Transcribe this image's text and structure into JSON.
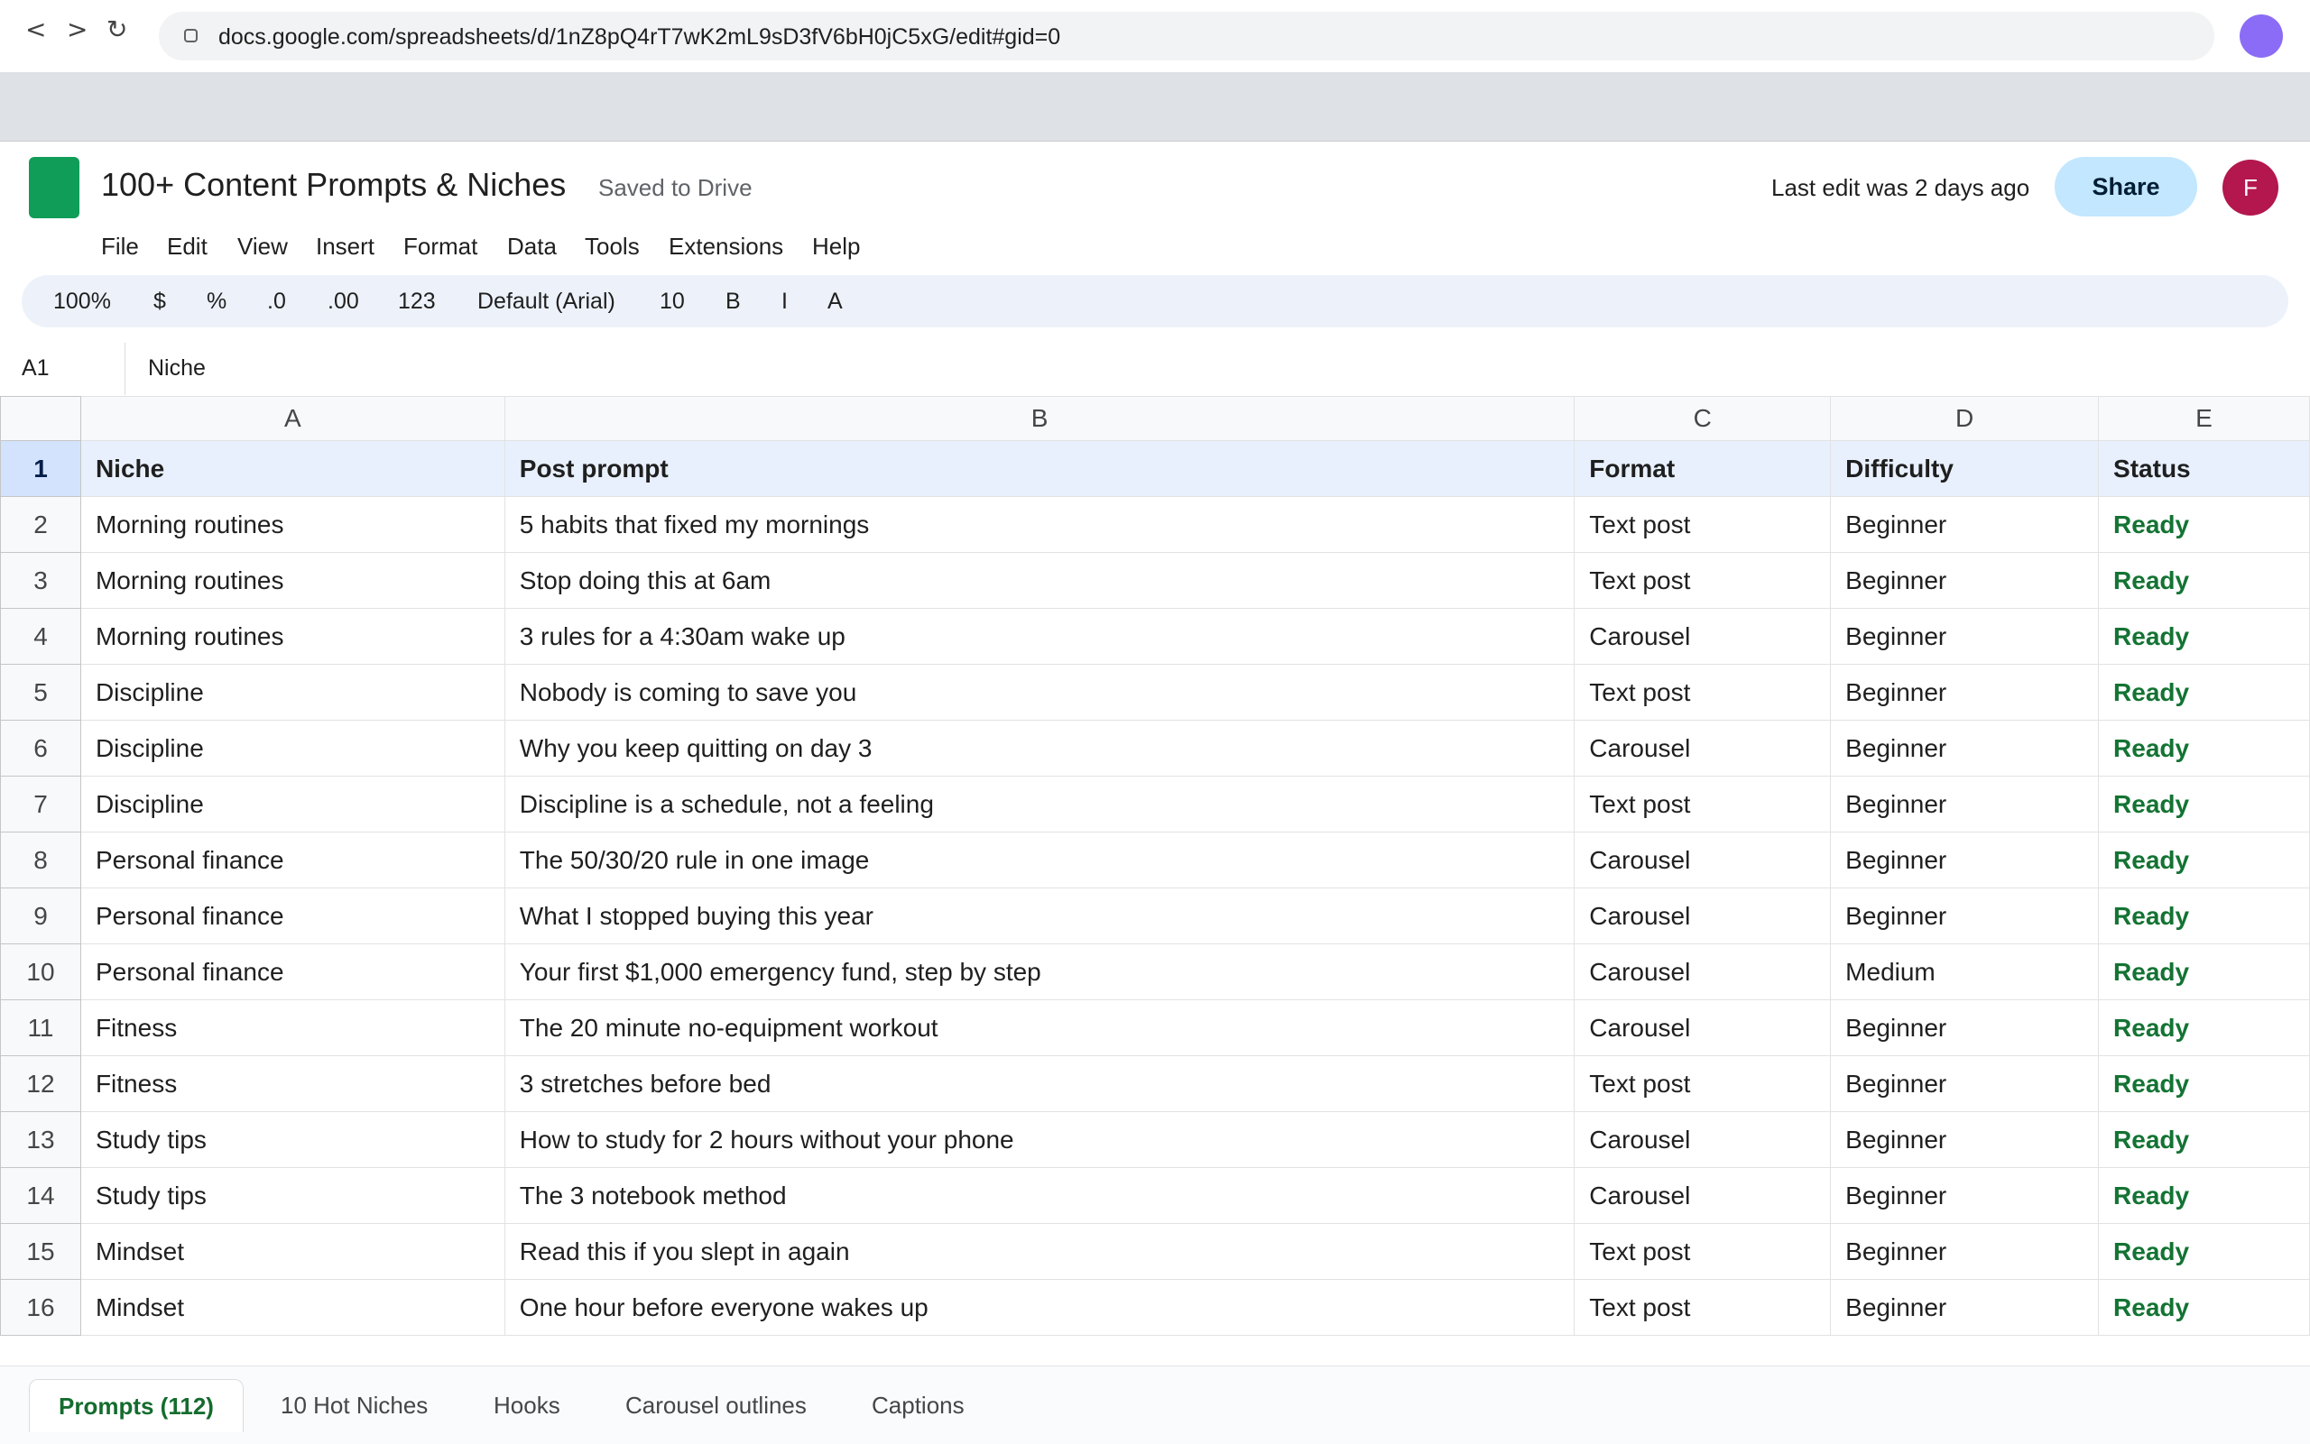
{
  "browser": {
    "url": "docs.google.com/spreadsheets/d/1nZ8pQ4rT7wK2mL9sD3fV6bH0jC5xG/edit#gid=0",
    "back": "<",
    "forward": ">",
    "reload": "↻"
  },
  "header": {
    "title": "100+ Content Prompts & Niches",
    "saved": "Saved to Drive",
    "last_edit": "Last edit was 2 days ago",
    "share": "Share",
    "avatar_initial": "F"
  },
  "menu": [
    "File",
    "Edit",
    "View",
    "Insert",
    "Format",
    "Data",
    "Tools",
    "Extensions",
    "Help"
  ],
  "toolbar": {
    "zoom": "100%",
    "currency": "$",
    "percent": "%",
    "dec_less": ".0",
    "dec_more": ".00",
    "number_format": "123",
    "font": "Default (Arial)",
    "font_size": "10",
    "bold": "B",
    "italic": "I",
    "text_color": "A"
  },
  "formula_bar": {
    "cell_ref": "A1",
    "value": "Niche"
  },
  "grid": {
    "columns": [
      "A",
      "B",
      "C",
      "D",
      "E"
    ],
    "header": [
      "Niche",
      "Post prompt",
      "Format",
      "Difficulty",
      "Status"
    ],
    "rows": [
      [
        "Morning routines",
        "5 habits that fixed my mornings",
        "Text post",
        "Beginner",
        "Ready"
      ],
      [
        "Morning routines",
        "Stop doing this at 6am",
        "Text post",
        "Beginner",
        "Ready"
      ],
      [
        "Morning routines",
        "3 rules for a 4:30am wake up",
        "Carousel",
        "Beginner",
        "Ready"
      ],
      [
        "Discipline",
        "Nobody is coming to save you",
        "Text post",
        "Beginner",
        "Ready"
      ],
      [
        "Discipline",
        "Why you keep quitting on day 3",
        "Carousel",
        "Beginner",
        "Ready"
      ],
      [
        "Discipline",
        "Discipline is a schedule, not a feeling",
        "Text post",
        "Beginner",
        "Ready"
      ],
      [
        "Personal finance",
        "The 50/30/20 rule in one image",
        "Carousel",
        "Beginner",
        "Ready"
      ],
      [
        "Personal finance",
        "What I stopped buying this year",
        "Carousel",
        "Beginner",
        "Ready"
      ],
      [
        "Personal finance",
        "Your first $1,000 emergency fund, step by step",
        "Carousel",
        "Medium",
        "Ready"
      ],
      [
        "Fitness",
        "The 20 minute no-equipment workout",
        "Carousel",
        "Beginner",
        "Ready"
      ],
      [
        "Fitness",
        "3 stretches before bed",
        "Text post",
        "Beginner",
        "Ready"
      ],
      [
        "Study tips",
        "How to study for 2 hours without your phone",
        "Carousel",
        "Beginner",
        "Ready"
      ],
      [
        "Study tips",
        "The 3 notebook method",
        "Carousel",
        "Beginner",
        "Ready"
      ],
      [
        "Mindset",
        "Read this if you slept in again",
        "Text post",
        "Beginner",
        "Ready"
      ],
      [
        "Mindset",
        "One hour before everyone wakes up",
        "Text post",
        "Beginner",
        "Ready"
      ]
    ]
  },
  "sheet_tabs": [
    "Prompts (112)",
    "10 Hot Niches",
    "Hooks",
    "Carousel outlines",
    "Captions"
  ],
  "colors": {
    "sheets_green": "#0f9d58",
    "share_bg": "#c2e7ff",
    "ready_green": "#137333",
    "avatar": "#b3174d"
  }
}
